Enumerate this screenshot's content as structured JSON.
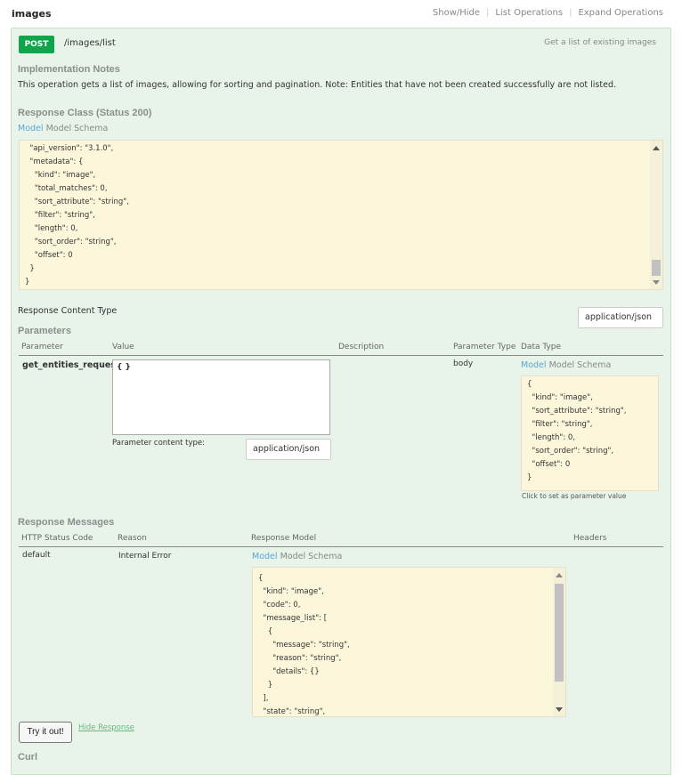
{
  "header": {
    "title": "images",
    "links": [
      "Show/Hide",
      "List Operations",
      "Expand Operations"
    ]
  },
  "operation": {
    "method": "POST",
    "path": "/images/list",
    "summary": "Get a list of existing images",
    "colors": {
      "method_bg": "#10a54a",
      "panel_bg": "#e8f3ea",
      "json_bg": "#fcf6db"
    }
  },
  "implementation": {
    "title": "Implementation Notes",
    "text": "This operation gets a list of images, allowing for sorting and pagination. Note: Entities that have not been created successfully are not listed."
  },
  "response_class": {
    "title": "Response Class (Status 200)",
    "tab_model": "Model",
    "tab_schema": "Model Schema",
    "json": "  \"api_version\": \"3.1.0\",\n  \"metadata\": {\n    \"kind\": \"image\",\n    \"total_matches\": 0,\n    \"sort_attribute\": \"string\",\n    \"filter\": \"string\",\n    \"length\": 0,\n    \"sort_order\": \"string\",\n    \"offset\": 0\n  }\n}"
  },
  "response_content_type": {
    "label": "Response Content Type",
    "value": "application/json"
  },
  "parameters": {
    "title": "Parameters",
    "headers": [
      "Parameter",
      "Value",
      "Description",
      "Parameter Type",
      "Data Type"
    ],
    "row": {
      "name": "get_entities_request",
      "value": "{ }",
      "description": "",
      "param_type": "body",
      "content_type_label": "Parameter content type:",
      "content_type_value": "application/json",
      "tab_model": "Model",
      "tab_schema": "Model Schema",
      "schema_json": "{\n  \"kind\": \"image\",\n  \"sort_attribute\": \"string\",\n  \"filter\": \"string\",\n  \"length\": 0,\n  \"sort_order\": \"string\",\n  \"offset\": 0\n}",
      "schema_note": "Click to set as parameter value"
    }
  },
  "response_messages": {
    "title": "Response Messages",
    "headers": [
      "HTTP Status Code",
      "Reason",
      "Response Model",
      "Headers"
    ],
    "row": {
      "code": "default",
      "reason": "Internal Error",
      "tab_model": "Model",
      "tab_schema": "Model Schema",
      "json": "{\n  \"kind\": \"image\",\n  \"code\": 0,\n  \"message_list\": [\n    {\n      \"message\": \"string\",\n      \"reason\": \"string\",\n      \"details\": {}\n    }\n  ],\n  \"state\": \"string\","
    }
  },
  "actions": {
    "try_label": "Try it out!",
    "hide_label": "Hide Response"
  },
  "curl": {
    "title": "Curl"
  }
}
